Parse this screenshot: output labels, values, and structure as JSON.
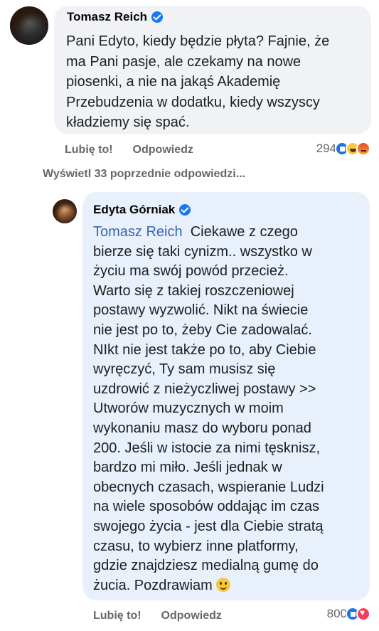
{
  "comment": {
    "author": "Tomasz Reich",
    "text_lines": [
      "Pani Edyto, kiedy będzie płyta? Fajnie, że",
      "ma Pani pasje, ale czekamy na nowe",
      "piosenki, a nie na jakąś Akademię",
      "Przebudzenia w dodatku, kiedy wszyscy",
      "kładziemy się spać."
    ],
    "like_label": "Lubię to!",
    "reply_label": "Odpowiedz",
    "reaction_count": "294",
    "reaction_icons": [
      "like-icon",
      "haha-icon",
      "angry-icon"
    ]
  },
  "view_previous": "Wyświetl 33 poprzednie odpowiedzi...",
  "reply": {
    "author": "Edyta Górniak",
    "mention": "Tomasz Reich",
    "first_line_rest": "Ciekawe z czego",
    "text_lines": [
      "bierze się taki cynizm.. wszystko w",
      "życiu ma swój powód przecież.",
      "Warto się z takiej roszczeniowej",
      "postawy wyzwolić. Nikt na świecie",
      "nie jest po to, żeby Cie zadowalać.",
      "NIkt nie jest także po to, aby Ciebie",
      "wyręczyć, Ty sam musisz się",
      "uzdrowić z nieżyczliwej postawy >>",
      "Utworów muzycznych w moim",
      "wykonaniu masz do wyboru ponad",
      "200. Jeśli w istocie za nimi tęsknisz,",
      "bardzo mi miło. Jeśli jednak w",
      "obecnych czasach, wspieranie Ludzi",
      "na wiele sposobów oddając im czas",
      "swojego życia - jest dla Ciebie stratą",
      "czasu, to wybierz inne platformy,",
      "gdzie znajdziesz medialną gumę do"
    ],
    "last_line": "żucia. Pozdrawiam",
    "like_label": "Lubię to!",
    "reply_label": "Odpowiedz",
    "reaction_count": "800",
    "reaction_icons": [
      "like-icon",
      "love-icon"
    ]
  }
}
